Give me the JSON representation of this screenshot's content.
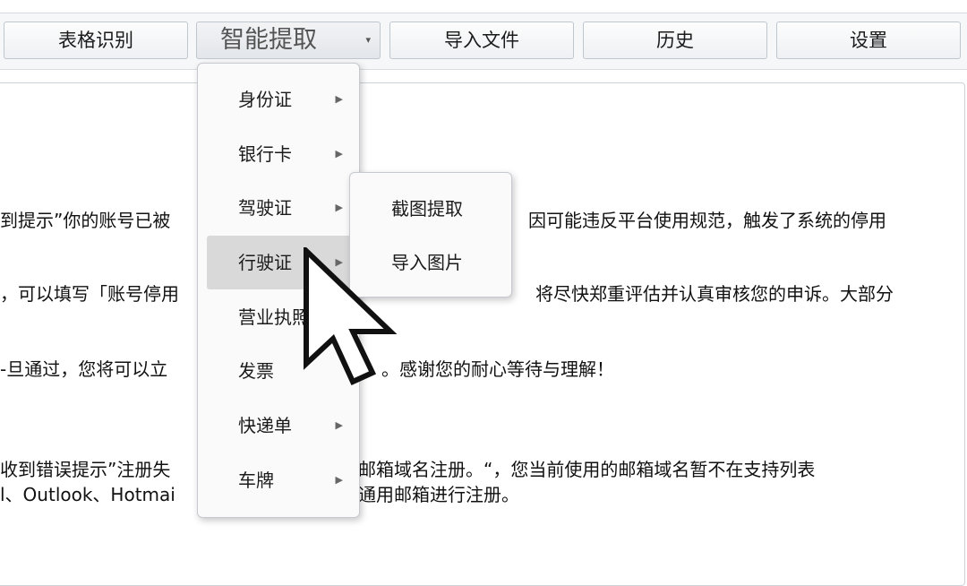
{
  "toolbar": {
    "tabs": [
      {
        "label": "表格识别"
      },
      {
        "label": "智能提取"
      },
      {
        "label": "导入文件"
      },
      {
        "label": "历史"
      },
      {
        "label": "设置"
      }
    ],
    "dropdown_arrow": "▾"
  },
  "content": {
    "lines": [
      "到提示”你的账号已被",
      "因可能违反平台使用规范，触发了系统的停用",
      "，可以填写「账号停用",
      "将尽快郑重评估并认真审核您的申诉。大部分",
      "-旦通过，您将可以立",
      "。感谢您的耐心等待与理解！",
      "收到错误提示”注册失",
      "邮箱域名注册。“，您当前使用的邮箱域名暂不在支持列表",
      "l、Outlook、Hotmai",
      "通用邮箱进行注册。"
    ]
  },
  "menu": {
    "items": [
      {
        "label": "身份证",
        "has_submenu": true
      },
      {
        "label": "银行卡",
        "has_submenu": true
      },
      {
        "label": "驾驶证",
        "has_submenu": true
      },
      {
        "label": "行驶证",
        "has_submenu": true,
        "highlighted": true
      },
      {
        "label": "营业执照",
        "has_submenu": false
      },
      {
        "label": "发票",
        "has_submenu": false
      },
      {
        "label": "快递单",
        "has_submenu": true
      },
      {
        "label": "车牌",
        "has_submenu": true
      }
    ],
    "submenu_arrow": "▶"
  },
  "submenu": {
    "items": [
      {
        "label": "截图提取"
      },
      {
        "label": "导入图片"
      }
    ]
  }
}
